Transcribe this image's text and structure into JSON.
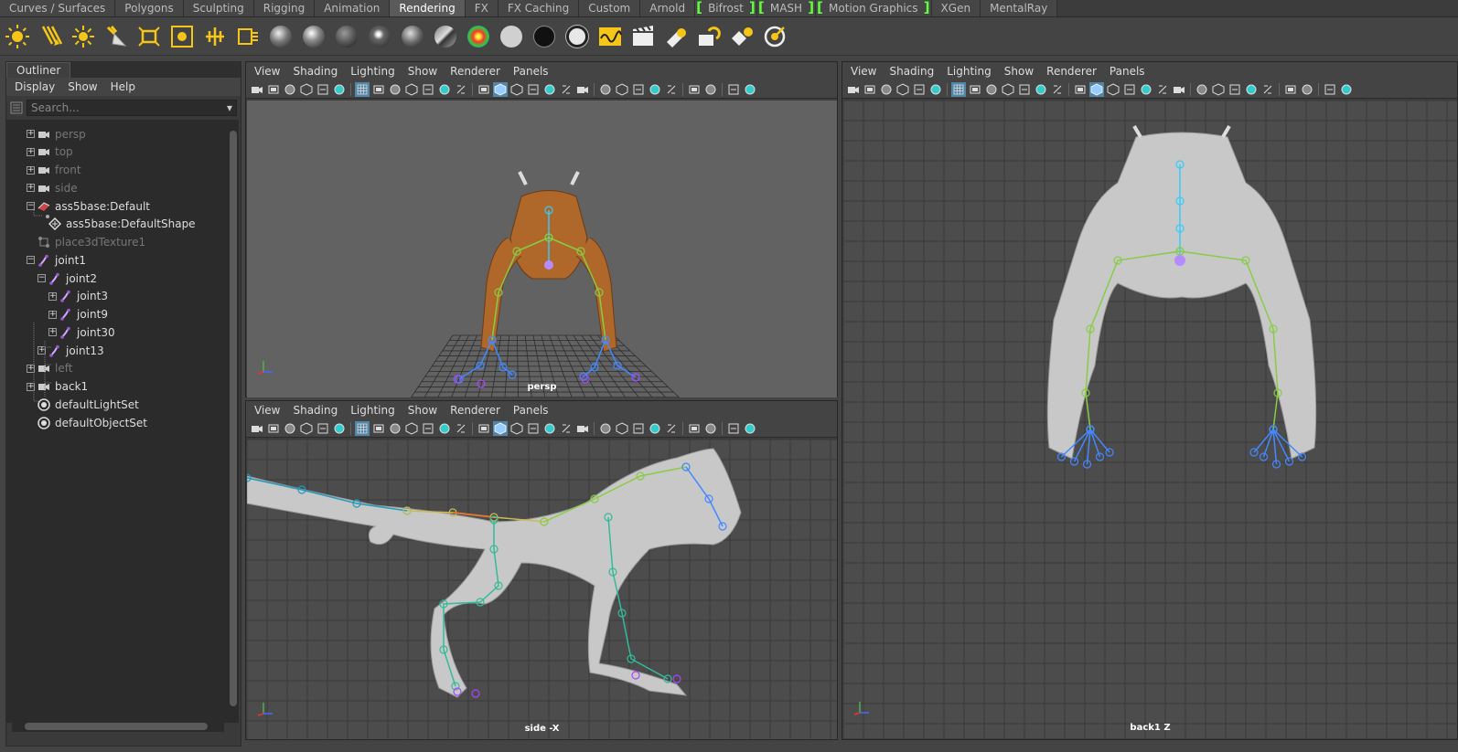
{
  "shelf_tabs": [
    {
      "label": "Curves / Surfaces",
      "active": false,
      "bracket": false
    },
    {
      "label": "Polygons",
      "active": false,
      "bracket": false
    },
    {
      "label": "Sculpting",
      "active": false,
      "bracket": false
    },
    {
      "label": "Rigging",
      "active": false,
      "bracket": false
    },
    {
      "label": "Animation",
      "active": false,
      "bracket": false
    },
    {
      "label": "Rendering",
      "active": true,
      "bracket": false
    },
    {
      "label": "FX",
      "active": false,
      "bracket": false
    },
    {
      "label": "FX Caching",
      "active": false,
      "bracket": false
    },
    {
      "label": "Custom",
      "active": false,
      "bracket": false
    },
    {
      "label": "Arnold",
      "active": false,
      "bracket": false
    },
    {
      "label": "Bifrost",
      "active": false,
      "bracket": true
    },
    {
      "label": "MASH",
      "active": false,
      "bracket": true
    },
    {
      "label": "Motion Graphics",
      "active": false,
      "bracket": true
    },
    {
      "label": "XGen",
      "active": false,
      "bracket": false
    },
    {
      "label": "MentalRay",
      "active": false,
      "bracket": false
    }
  ],
  "shelf_icons": [
    "ambient-light-icon",
    "directional-light-icon",
    "point-light-icon",
    "spot-light-icon",
    "area-light-icon",
    "volume-light-icon",
    "create-camera-icon",
    "camera-aim-icon",
    "lambert-material-icon",
    "blinn-material-icon",
    "phong-material-icon",
    "phong-e-material-icon",
    "anisotropic-material-icon",
    "layered-shader-icon",
    "ramp-shader-icon",
    "surface-shader-white-icon",
    "use-background-shader-icon",
    "shading-map-icon",
    "render-view-icon",
    "render-current-frame-icon",
    "ipr-render-icon",
    "render-settings-icon",
    "hypershade-icon",
    "render-globals-icon"
  ],
  "outliner": {
    "tab": "Outliner",
    "menu": [
      "Display",
      "Show",
      "Help"
    ],
    "search_placeholder": "Search...",
    "items": [
      {
        "label": "persp",
        "icon": "camera-icon",
        "dim": true,
        "expand": "+"
      },
      {
        "label": "top",
        "icon": "camera-icon",
        "dim": true,
        "expand": "+"
      },
      {
        "label": "front",
        "icon": "camera-icon",
        "dim": true,
        "expand": "+"
      },
      {
        "label": "side",
        "icon": "camera-icon",
        "dim": true,
        "expand": "+"
      },
      {
        "label": "ass5base:Default",
        "icon": "mesh-transform-icon",
        "dim": false,
        "expand": "−"
      },
      {
        "label": "ass5base:DefaultShape",
        "icon": "mesh-shape-icon",
        "dim": false,
        "expand": ""
      },
      {
        "label": "place3dTexture1",
        "icon": "place3d-texture-icon",
        "dim": true,
        "expand": ""
      },
      {
        "label": "joint1",
        "icon": "joint-icon",
        "dim": false,
        "expand": "−"
      },
      {
        "label": "joint2",
        "icon": "joint-icon",
        "dim": false,
        "expand": "−"
      },
      {
        "label": "joint3",
        "icon": "joint-icon",
        "dim": false,
        "expand": "+"
      },
      {
        "label": "joint9",
        "icon": "joint-icon",
        "dim": false,
        "expand": "+"
      },
      {
        "label": "joint30",
        "icon": "joint-icon",
        "dim": false,
        "expand": "+"
      },
      {
        "label": "joint13",
        "icon": "joint-icon",
        "dim": false,
        "expand": "+"
      },
      {
        "label": "left",
        "icon": "camera-icon",
        "dim": true,
        "expand": "+"
      },
      {
        "label": "back1",
        "icon": "camera-icon",
        "dim": false,
        "expand": "+"
      },
      {
        "label": "defaultLightSet",
        "icon": "object-set-icon",
        "dim": false,
        "expand": ""
      },
      {
        "label": "defaultObjectSet",
        "icon": "object-set-icon",
        "dim": false,
        "expand": ""
      }
    ]
  },
  "panel_menu": [
    "View",
    "Shading",
    "Lighting",
    "Show",
    "Renderer",
    "Panels"
  ],
  "viewports": {
    "persp": {
      "label": "persp"
    },
    "side": {
      "label": "side -X"
    },
    "back": {
      "label": "back1 Z"
    }
  },
  "colors": {
    "active_tab": "#5a5a5a",
    "toggle_on": "#5285a6",
    "bracket": "#5fff3f",
    "creature_textured": "#b0672a",
    "creature_gray": "#c8c8c8",
    "grid_bg": "#4c4c4c"
  }
}
